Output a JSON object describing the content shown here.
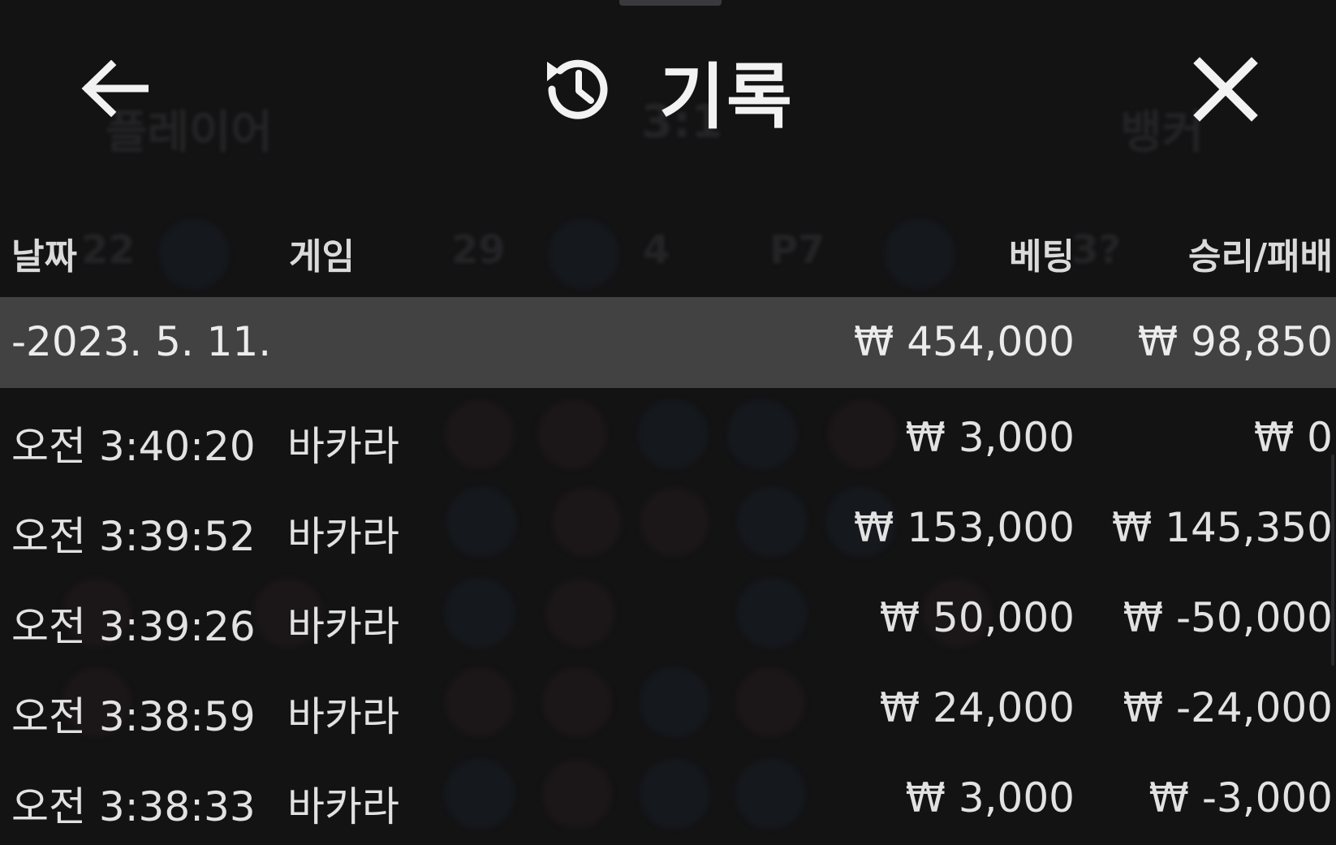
{
  "header": {
    "title": "기록",
    "icons": {
      "back": "arrow-left-icon",
      "history": "history-icon",
      "close": "close-icon"
    }
  },
  "background_ghost": {
    "tabs": [
      "플레이어",
      "3:1",
      "뱅커"
    ],
    "numbers": [
      "22",
      "29",
      "4",
      "P7",
      "3?"
    ]
  },
  "columns": {
    "date": "날짜",
    "game": "게임",
    "bet": "베팅",
    "win_loss": "승리/패배"
  },
  "summary": {
    "date": "-2023. 5. 11.",
    "bet": "₩ 454,000",
    "win_loss": "₩ 98,850"
  },
  "rows": [
    {
      "time": "오전 3:40:20",
      "game": "바카라",
      "bet": "₩ 3,000",
      "win_loss": "₩ 0"
    },
    {
      "time": "오전 3:39:52",
      "game": "바카라",
      "bet": "₩ 153,000",
      "win_loss": "₩ 145,350"
    },
    {
      "time": "오전 3:39:26",
      "game": "바카라",
      "bet": "₩ 50,000",
      "win_loss": "₩ -50,000"
    },
    {
      "time": "오전 3:38:59",
      "game": "바카라",
      "bet": "₩ 24,000",
      "win_loss": "₩ -24,000"
    },
    {
      "time": "오전 3:38:33",
      "game": "바카라",
      "bet": "₩ 3,000",
      "win_loss": "₩ -3,000"
    }
  ],
  "colors": {
    "background": "#131314",
    "summary_row": "#424243",
    "text": "#e2e2e2"
  }
}
